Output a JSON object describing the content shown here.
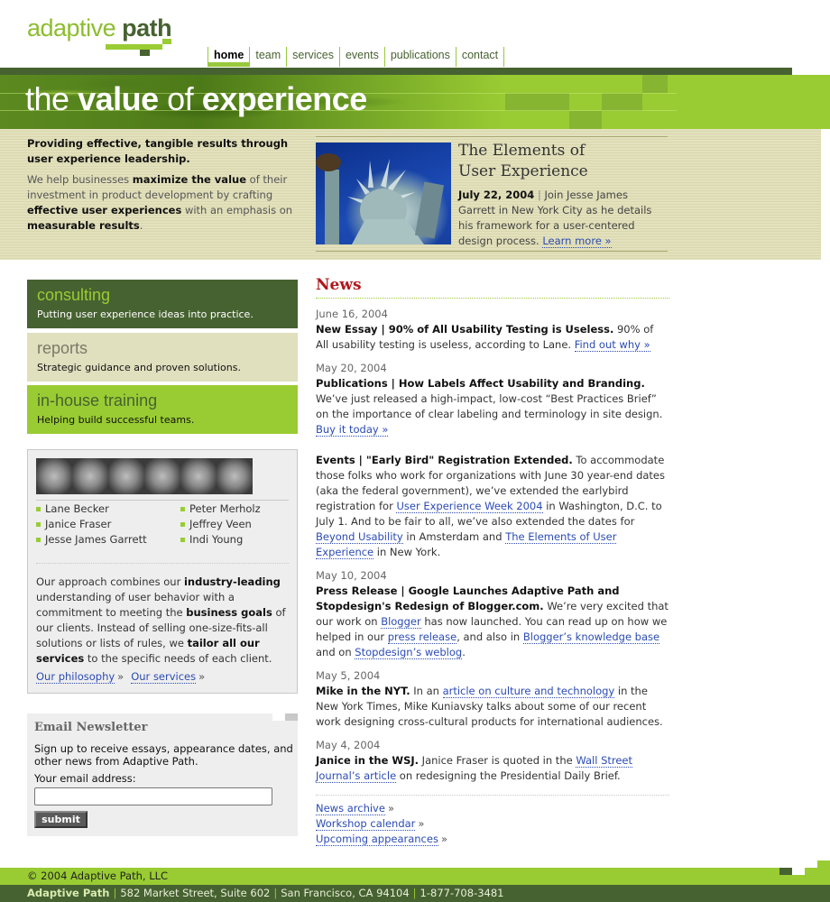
{
  "logo": {
    "part1": "adaptive",
    "part2": "path"
  },
  "nav": [
    {
      "label": "home",
      "active": true
    },
    {
      "label": "team"
    },
    {
      "label": "services"
    },
    {
      "label": "events"
    },
    {
      "label": "publications"
    },
    {
      "label": "contact"
    }
  ],
  "banner": {
    "w1": "the",
    "w2": "value",
    "w3": "of",
    "w4": "experience"
  },
  "intro": {
    "lead": "Providing effective, tangible results through user experience leadership.",
    "body_1": "We help businesses ",
    "body_b1": "maximize the value",
    "body_2": " of their investment in product development by crafting ",
    "body_b2": "effective user experiences",
    "body_3": " with an emphasis on ",
    "body_b3": "measurable results",
    "body_4": "."
  },
  "feature": {
    "image_alt": "statue-of-liberty",
    "title_line1": "The Elements of",
    "title_line2": "User Experience",
    "date": "July 22, 2004",
    "sep": " | ",
    "text": "Join Jesse James Garrett in New York City as he details his framework for a user-centered design process. ",
    "link": "Learn more »"
  },
  "services": [
    {
      "title": "consulting",
      "desc": "Putting user experience ideas into practice."
    },
    {
      "title": "reports",
      "desc": "Strategic guidance and proven solutions."
    },
    {
      "title": "in-house training",
      "desc": "Helping build successful teams."
    }
  ],
  "team": {
    "members": [
      "Lane Becker",
      "Peter Merholz",
      "Janice Fraser",
      "Jeffrey Veen",
      "Jesse James Garrett",
      "Indi Young"
    ],
    "approach_1": "Our approach combines our ",
    "approach_b1": "industry-leading",
    "approach_2": " understanding of user behavior with a commitment to meeting the ",
    "approach_b2": "business goals",
    "approach_3": " of our clients. Instead of selling one-size-fits-all solutions or lists of rules, we ",
    "approach_b3": "tailor all our services",
    "approach_4": " to the specific needs of each client.",
    "link_philosophy": "Our philosophy",
    "link_services": "Our services",
    "raquo": "»"
  },
  "newsletter": {
    "title": "Email Newsletter",
    "desc": "Sign up to receive essays, appearance dates, and other news from Adaptive Path.",
    "label": "Your email address:",
    "value": "",
    "submit": "submit"
  },
  "news": {
    "title": "News",
    "items": [
      {
        "date": "June 16, 2004",
        "head": "New Essay | 90% of All Usability Testing is Useless.",
        "t1": " 90% of All usability testing is useless, according to Lane. ",
        "l1": "Find out why »"
      },
      {
        "date": "May 20, 2004",
        "head": "Publications | How Labels Affect Usability and Branding.",
        "t1": " We’ve just released a high-impact, low-cost “Best Practices Brief” on the importance of clear labeling and terminology in site design. ",
        "l1": "Buy it today »"
      },
      {
        "date": "",
        "head": "Events | \"Early Bird\" Registration Extended.",
        "t1": " To accommodate those folks who work for organizations with June 30 year-end dates (aka the federal government), we’ve extended the earlybird registration for ",
        "l1": "User Experience Week 2004",
        "t2": " in Washington, D.C. to July 1. And to be fair to all, we’ve also extended the dates for ",
        "l2": "Beyond Usability",
        "t3": " in Amsterdam and ",
        "l3": "The Elements of User Experience",
        "t4": " in New York."
      },
      {
        "date": "May 10, 2004",
        "head": "Press Release | Google Launches Adaptive Path and Stopdesign's Redesign of Blogger.com.",
        "t1": " We’re very excited that our work on ",
        "l1": "Blogger",
        "t2": " has now launched. You can read up on how we helped in our ",
        "l2": "press release",
        "t3": ", and also in ",
        "l3": "Blogger’s knowledge base",
        "t4": " and on ",
        "l4": "Stopdesign’s weblog",
        "t5": "."
      },
      {
        "date": "May 5, 2004",
        "head": "Mike in the NYT.",
        "t1": " In an ",
        "l1": "article on culture and technology",
        "t2": " in the New York Times, Mike Kuniavsky talks about some of our recent work designing cross-cultural products for international audiences."
      },
      {
        "date": "May 4, 2004",
        "head": "Janice in the WSJ.",
        "t1": " Janice Fraser is quoted in the ",
        "l1": "Wall Street Journal’s article",
        "t2": " on redesigning the Presidential Daily Brief."
      }
    ],
    "links": [
      "News archive",
      "Workshop calendar",
      "Upcoming appearances"
    ],
    "raquo": "»"
  },
  "footer": {
    "copyright": "© 2004 Adaptive Path, LLC",
    "brand": "Adaptive Path",
    "street": "582 Market Street, Suite 602",
    "city": "San Francisco, CA 94104",
    "phone": "1-877-708-3481",
    "pipe": "|"
  },
  "colors": {
    "dark_green": "#476231",
    "lime": "#99cc33",
    "beige": "#e0dfbe",
    "news_red": "#b0171b",
    "link": "#2b4bb3"
  }
}
